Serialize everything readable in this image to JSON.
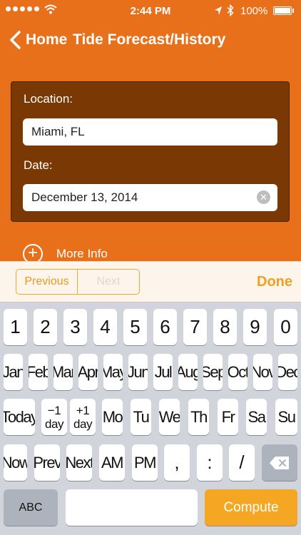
{
  "status_bar": {
    "time": "2:44 PM",
    "battery": "100%"
  },
  "nav": {
    "back_label": "Home",
    "title": "Tide Forecast/History"
  },
  "form": {
    "location_label": "Location:",
    "location_value": "Miami, FL",
    "date_label": "Date:",
    "date_value": "December 13, 2014",
    "clear_glyph": "✕"
  },
  "more_info": {
    "label": "More Info",
    "icon_glyph": "+"
  },
  "accessory": {
    "previous": "Previous",
    "next": "Next",
    "done": "Done"
  },
  "keyboard": {
    "row1": [
      "1",
      "2",
      "3",
      "4",
      "5",
      "6",
      "7",
      "8",
      "9",
      "0"
    ],
    "row2": [
      "Jan",
      "Feb",
      "Mar",
      "Apr",
      "May",
      "Jun",
      "Jul",
      "Aug",
      "Sep",
      "Oct",
      "Nov",
      "Dec"
    ],
    "row3": {
      "today": "Today",
      "minus_day": [
        "−1",
        "day"
      ],
      "plus_day": [
        "+1",
        "day"
      ],
      "days": [
        "Mo",
        "Tu",
        "We",
        "Th",
        "Fr",
        "Sa",
        "Su"
      ]
    },
    "row4": [
      "Now",
      "Prev",
      "Next",
      "AM",
      "PM",
      ",",
      ":",
      "/"
    ],
    "abc": "ABC",
    "space": "",
    "compute": "Compute"
  },
  "colors": {
    "background": "#E8701A",
    "panel": "#7A3904",
    "accent": "#F5A623"
  }
}
